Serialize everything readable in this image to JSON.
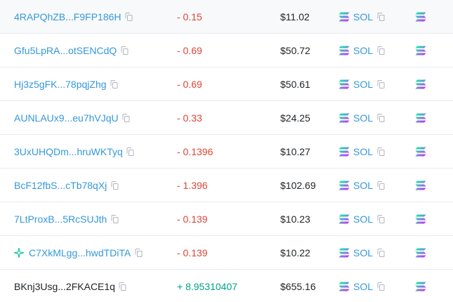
{
  "rows": [
    {
      "address": "4RAPQhZB...F9FP186H",
      "linked": true,
      "icon": "",
      "amount": "- 0.15",
      "direction": "out",
      "value": "$11.02",
      "token": "SOL"
    },
    {
      "address": "Gfu5LpRA...otSENCdQ",
      "linked": true,
      "icon": "",
      "amount": "- 0.69",
      "direction": "out",
      "value": "$50.72",
      "token": "SOL"
    },
    {
      "address": "Hj3z5gFK...78pqjZhg",
      "linked": true,
      "icon": "",
      "amount": "- 0.69",
      "direction": "out",
      "value": "$50.61",
      "token": "SOL"
    },
    {
      "address": "AUNLAUx9...eu7hVJqU",
      "linked": true,
      "icon": "",
      "amount": "- 0.33",
      "direction": "out",
      "value": "$24.25",
      "token": "SOL"
    },
    {
      "address": "3UxUHQDm...hruWKTyq",
      "linked": true,
      "icon": "",
      "amount": "- 0.1396",
      "direction": "out",
      "value": "$10.27",
      "token": "SOL"
    },
    {
      "address": "BcF12fbS...cTb78qXj",
      "linked": true,
      "icon": "",
      "amount": "- 1.396",
      "direction": "out",
      "value": "$102.69",
      "token": "SOL"
    },
    {
      "address": "7LtProxB...5RcSUJth",
      "linked": true,
      "icon": "",
      "amount": "- 0.139",
      "direction": "out",
      "value": "$10.23",
      "token": "SOL"
    },
    {
      "address": "C7XkMLgg...hwdTDiTA",
      "linked": true,
      "icon": "sparkle-star-icon",
      "amount": "- 0.139",
      "direction": "out",
      "value": "$10.22",
      "token": "SOL"
    },
    {
      "address": "BKnj3Usg...2FKACE1q",
      "linked": false,
      "icon": "",
      "amount": "+ 8.95310407",
      "direction": "in",
      "value": "$655.16",
      "token": "SOL"
    }
  ],
  "icons": {
    "copy": "copy-icon",
    "token": "solana-logo-icon"
  },
  "colors": {
    "link": "#3498db",
    "negative": "#de4437",
    "positive": "#00a186",
    "row_border": "#e7eaf3",
    "highlight_row": "#f8f9fa",
    "solana_gradient_start": "#00FFA3",
    "solana_gradient_end": "#DC1FFF"
  }
}
